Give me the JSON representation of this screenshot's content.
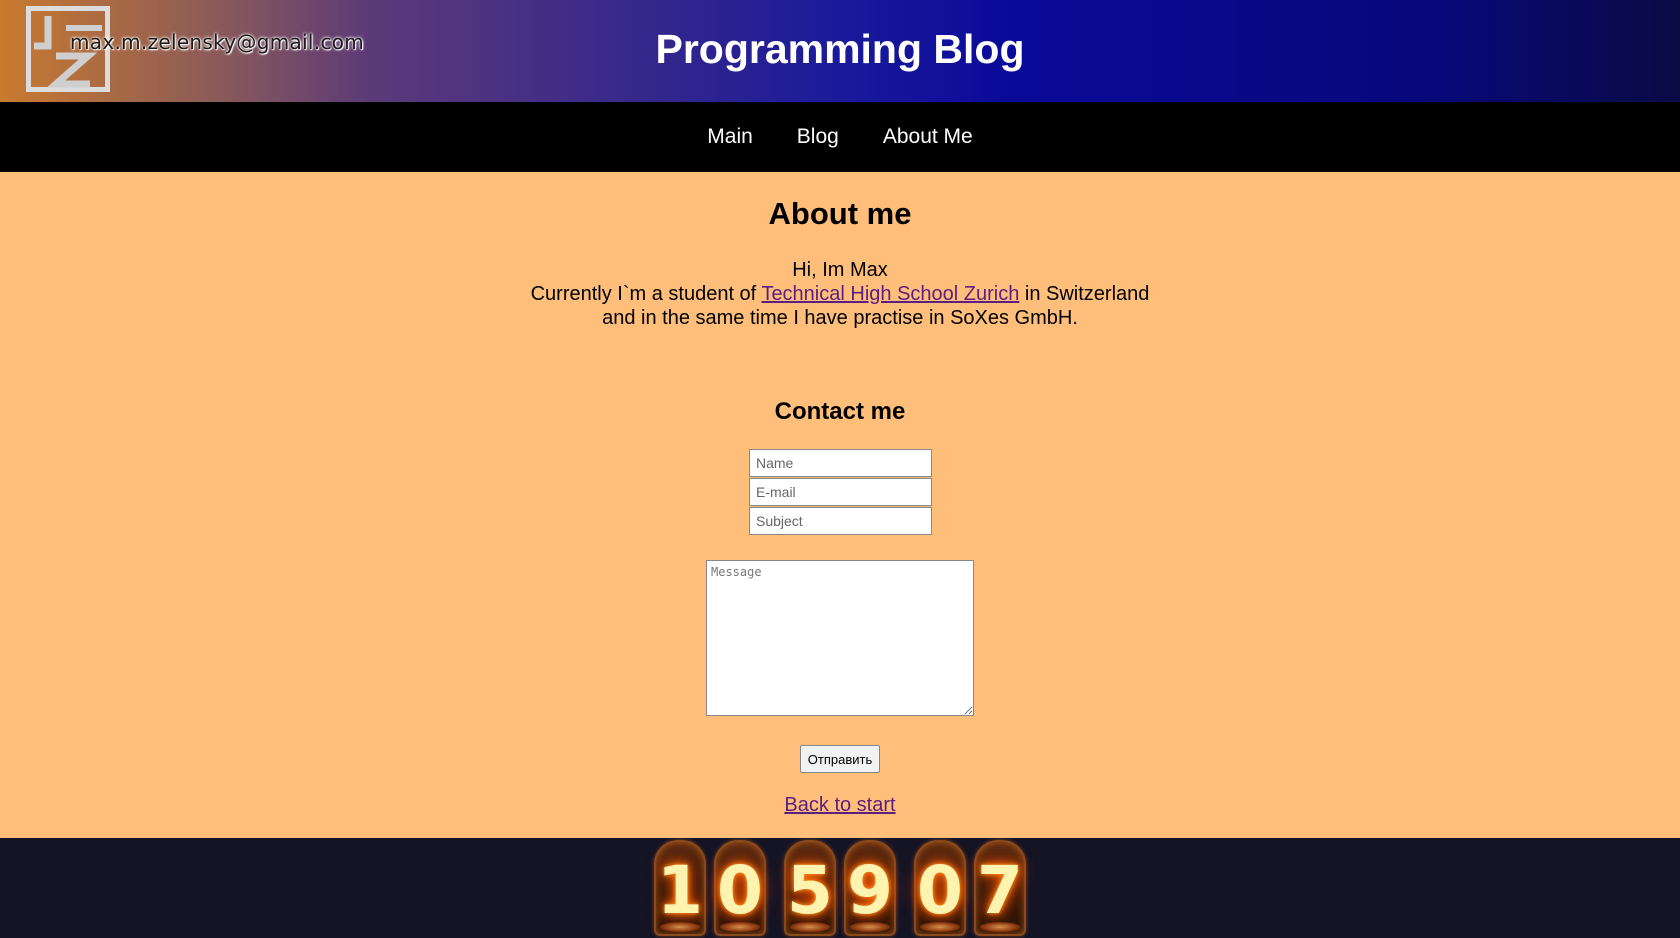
{
  "header": {
    "email": "max.m.zelensky@gmail.com",
    "title": "Programming Blog"
  },
  "nav": {
    "items": [
      {
        "label": "Main"
      },
      {
        "label": "Blog"
      },
      {
        "label": "About Me"
      }
    ]
  },
  "about": {
    "title": "About me",
    "greeting": "Hi, Im Max",
    "line2_before": "Currently I`m a student of ",
    "school_link": "Technical High School Zurich",
    "line2_after": " in Switzerland",
    "line3": "and in the same time I have practise in SoXes GmbH."
  },
  "contact": {
    "title": "Contact me",
    "name_placeholder": "Name",
    "email_placeholder": "E-mail",
    "subject_placeholder": "Subject",
    "message_placeholder": "Message",
    "submit_label": "Отправить",
    "back_link": "Back to start"
  },
  "counter": {
    "digits": [
      "1",
      "0",
      "5",
      "9",
      "0",
      "7"
    ]
  },
  "colors": {
    "page_background": "#ffbf7b",
    "nav_background": "#000000",
    "footer_background": "#141425",
    "link_color": "#5a1f80"
  }
}
